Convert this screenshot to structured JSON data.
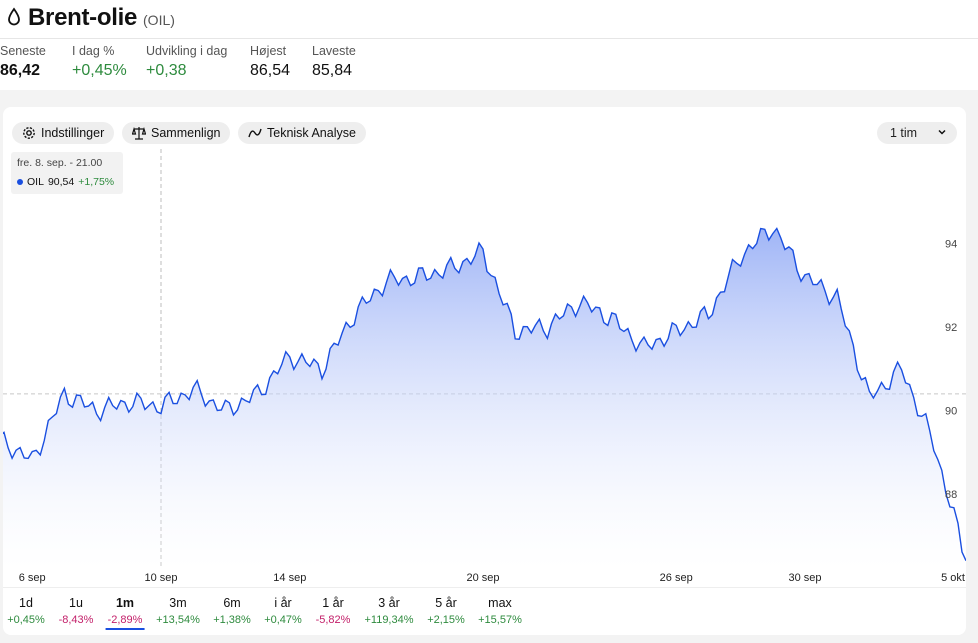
{
  "header": {
    "title": "Brent-olie",
    "ticker": "(OIL)"
  },
  "stats": [
    {
      "label": "Seneste",
      "value": "86,42"
    },
    {
      "label": "I dag %",
      "value": "+0,45%"
    },
    {
      "label": "Udvikling i dag",
      "value": "+0,38"
    },
    {
      "label": "Højest",
      "value": "86,54"
    },
    {
      "label": "Laveste",
      "value": "85,84"
    }
  ],
  "toolbar": {
    "settings_label": "Indstillinger",
    "compare_label": "Sammenlign",
    "technical_label": "Teknisk Analyse",
    "interval_value": "1 tim"
  },
  "tooltip": {
    "datetime": "fre. 8. sep. - 21.00",
    "symbol": "OIL",
    "price": "90,54",
    "change": "+1,75%"
  },
  "ranges": [
    {
      "label": "1d",
      "change": "+0,45%",
      "dir": "pos"
    },
    {
      "label": "1u",
      "change": "-8,43%",
      "dir": "neg"
    },
    {
      "label": "1m",
      "change": "-2,89%",
      "dir": "neg",
      "active": true
    },
    {
      "label": "3m",
      "change": "+13,54%",
      "dir": "pos"
    },
    {
      "label": "6m",
      "change": "+1,38%",
      "dir": "pos"
    },
    {
      "label": "i år",
      "change": "+0,47%",
      "dir": "pos"
    },
    {
      "label": "1 år",
      "change": "-5,82%",
      "dir": "neg"
    },
    {
      "label": "3 år",
      "change": "+119,34%",
      "dir": "pos"
    },
    {
      "label": "5 år",
      "change": "+2,15%",
      "dir": "pos"
    },
    {
      "label": "max",
      "change": "+15,57%",
      "dir": "pos"
    }
  ],
  "colors": {
    "line": "#1a4fe0",
    "positive": "#2e8b3e",
    "negative": "#c3206a"
  },
  "chart_data": {
    "type": "area",
    "series": [
      {
        "name": "OIL",
        "x": [
          "5 sep",
          "6 sep",
          "7 sep",
          "8 sep",
          "9 sep",
          "10 sep",
          "11 sep",
          "12 sep",
          "13 sep",
          "14 sep",
          "15 sep",
          "16 sep",
          "17 sep",
          "18 sep",
          "19 sep",
          "20 sep",
          "21 sep",
          "22 sep",
          "23 sep",
          "24 sep",
          "25 sep",
          "26 sep",
          "27 sep",
          "28 sep",
          "29 sep",
          "30 sep",
          "1 okt",
          "2 okt",
          "3 okt",
          "4 okt",
          "5 okt"
        ],
        "values": [
          89.3,
          88.8,
          90.4,
          90.0,
          90.2,
          90.1,
          90.5,
          90.0,
          90.4,
          91.3,
          91.0,
          92.3,
          93.1,
          93.2,
          93.4,
          93.8,
          91.9,
          92.0,
          92.6,
          92.2,
          91.5,
          91.9,
          92.3,
          93.7,
          94.4,
          93.2,
          92.7,
          90.3,
          91.0,
          89.2,
          86.4
        ]
      }
    ],
    "x_tick_labels": [
      "6 sep",
      "10 sep",
      "14 sep",
      "20 sep",
      "26 sep",
      "30 sep",
      "5 okt"
    ],
    "y_tick_labels": [
      "94",
      "92",
      "90",
      "88"
    ],
    "reference_line": 90.4,
    "ylim": [
      86.2,
      95.0
    ]
  }
}
